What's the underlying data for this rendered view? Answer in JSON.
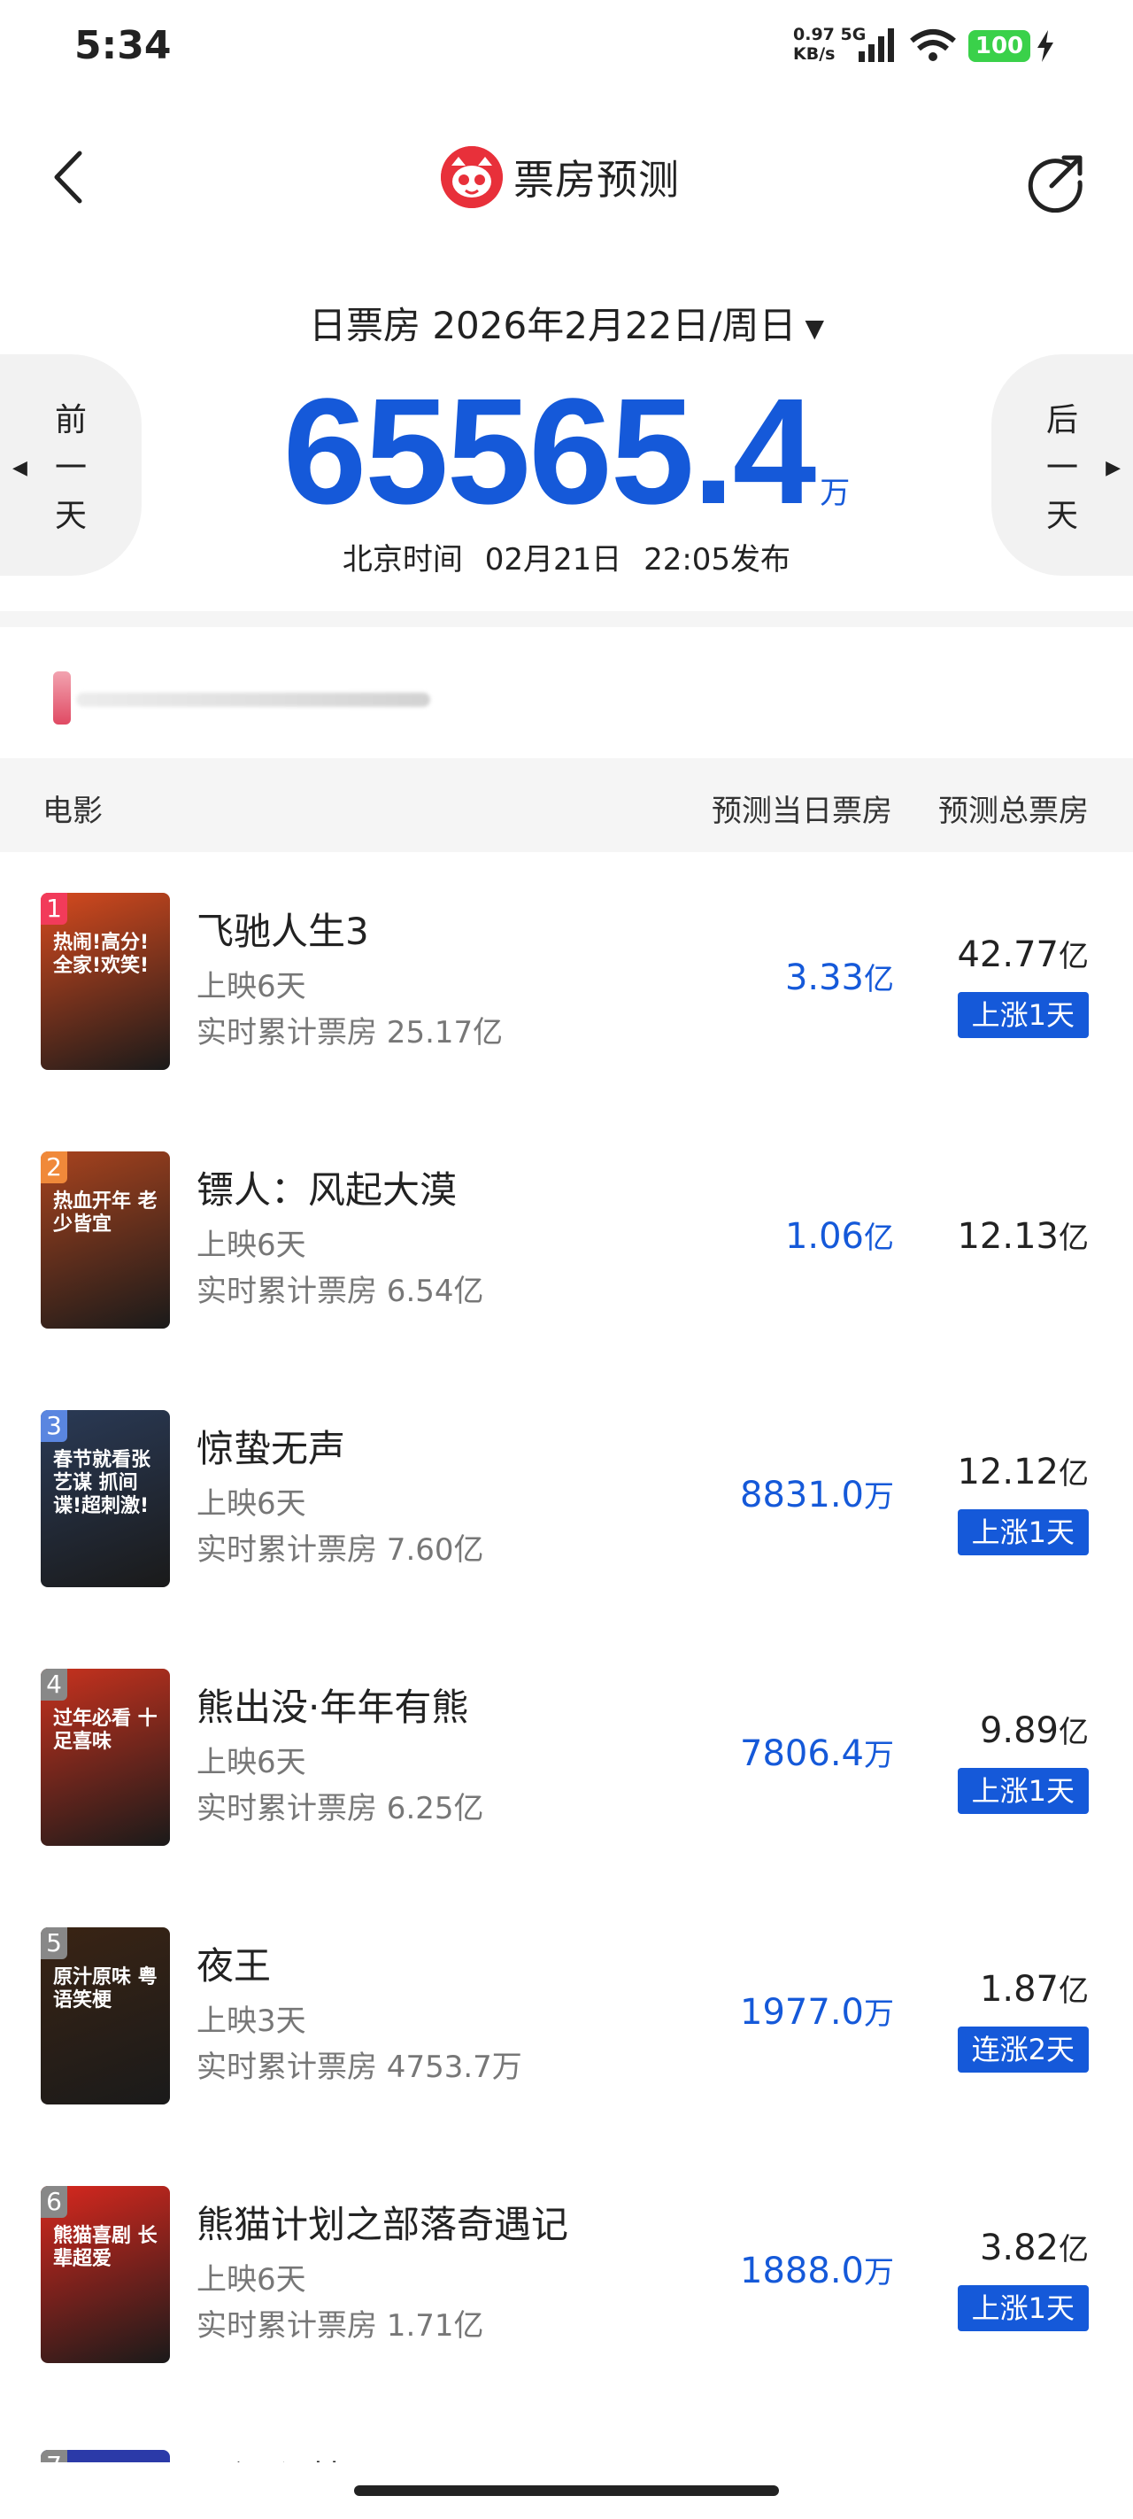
{
  "status": {
    "time": "5:34",
    "net_speed_top": "0.97 5G",
    "net_speed_bottom": "KB/s",
    "battery": "100"
  },
  "header": {
    "title": "票房预测"
  },
  "date": {
    "label": "日票房",
    "value": "2026年2月22日/周日",
    "prev_label": [
      "前",
      "一",
      "天"
    ],
    "next_label": [
      "后",
      "一",
      "天"
    ]
  },
  "total": {
    "amount": "65565.4",
    "unit": "万",
    "publish_prefix": "北京时间",
    "publish_date": "02月21日",
    "publish_time": "22:05发布"
  },
  "table": {
    "col_movie": "电影",
    "col_today": "预测当日票房",
    "col_total": "预测总票房"
  },
  "movies": [
    {
      "rank": "1",
      "title": "飞驰人生3",
      "days": "上映6天",
      "cumulative": "实时累计票房 25.17亿",
      "today_value": "3.33",
      "today_unit": "亿",
      "total_value": "42.77",
      "total_unit": "亿",
      "trend": "上涨1天",
      "poster_text": "热闹!高分!全家!欢笑!",
      "poster_color": "#d64a1e"
    },
    {
      "rank": "2",
      "title": "镖人：风起大漠",
      "days": "上映6天",
      "cumulative": "实时累计票房 6.54亿",
      "today_value": "1.06",
      "today_unit": "亿",
      "total_value": "12.13",
      "total_unit": "亿",
      "trend": "",
      "poster_text": "热血开年 老少皆宜",
      "poster_color": "#a8431e"
    },
    {
      "rank": "3",
      "title": "惊蛰无声",
      "days": "上映6天",
      "cumulative": "实时累计票房 7.60亿",
      "today_value": "8831.0",
      "today_unit": "万",
      "total_value": "12.12",
      "total_unit": "亿",
      "trend": "上涨1天",
      "poster_text": "春节就看张艺谋 抓间谍!超刺激!",
      "poster_color": "#2a3a56"
    },
    {
      "rank": "4",
      "title": "熊出没·年年有熊",
      "days": "上映6天",
      "cumulative": "实时累计票房 6.25亿",
      "today_value": "7806.4",
      "today_unit": "万",
      "total_value": "9.89",
      "total_unit": "亿",
      "trend": "上涨1天",
      "poster_text": "过年必看 十足喜味",
      "poster_color": "#c8321e"
    },
    {
      "rank": "5",
      "title": "夜王",
      "days": "上映3天",
      "cumulative": "实时累计票房 4753.7万",
      "today_value": "1977.0",
      "today_unit": "万",
      "total_value": "1.87",
      "total_unit": "亿",
      "trend": "连涨2天",
      "poster_text": "原汁原味 粤语笑梗",
      "poster_color": "#3a2414"
    },
    {
      "rank": "6",
      "title": "熊猫计划之部落奇遇记",
      "days": "上映6天",
      "cumulative": "实时累计票房 1.71亿",
      "today_value": "1888.0",
      "today_unit": "万",
      "total_value": "3.82",
      "total_unit": "亿",
      "trend": "上涨1天",
      "poster_text": "熊猫喜剧 长辈超爱",
      "poster_color": "#d8281e"
    }
  ],
  "next_partial": {
    "rank": "7",
    "title": "星河入梦"
  }
}
